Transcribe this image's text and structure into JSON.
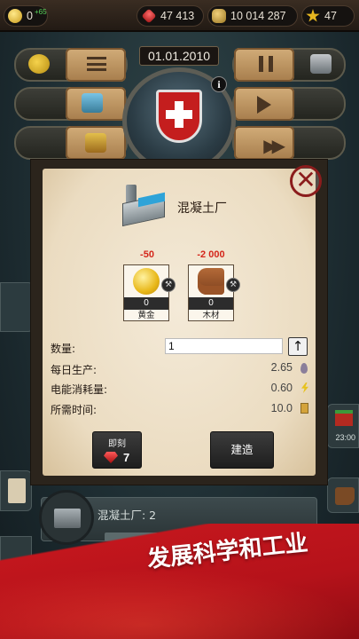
{
  "top_bar": {
    "gold": "0",
    "gold_income": "+65",
    "gems": "47 413",
    "money": "10 014 287",
    "stars": "47"
  },
  "hub": {
    "date": "01.01.2010",
    "info_label": "i"
  },
  "dialog": {
    "title": "混凝土厂",
    "close_label": "✕",
    "costs": [
      {
        "amount": "-50",
        "quantity": "0",
        "name": "黄金",
        "icon": "gold-coin-icon"
      },
      {
        "amount": "-2 000",
        "quantity": "0",
        "name": "木材",
        "icon": "wood-logs-icon"
      }
    ],
    "quantity_label": "数量:",
    "quantity_value": "1",
    "up_label": "↑",
    "stats": {
      "production_label": "每日生产:",
      "production_value": "2.65",
      "power_label": "电能消耗量:",
      "power_value": "0.60",
      "time_label": "所需时间:",
      "time_value": "10.0"
    },
    "instant_label": "即刻",
    "instant_cost": "7",
    "build_label": "建造"
  },
  "side": {
    "timer": "23:00"
  },
  "list": {
    "row_label": "混凝土厂: 2"
  },
  "banner": {
    "text": "发展科学和工业"
  },
  "colors": {
    "cost_red": "#d4261b",
    "banner_red": "#c2161d",
    "close_red": "#8b1c1c"
  }
}
